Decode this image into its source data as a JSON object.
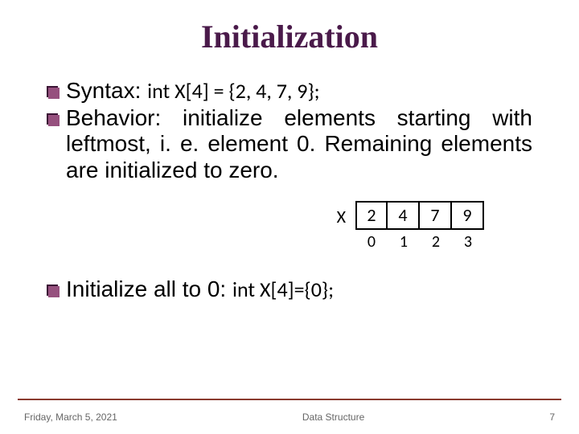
{
  "title": "Initialization",
  "bullets": {
    "b1": {
      "prefix": "Syntax: ",
      "code": "int X[4] = {2, 4, 7, 9};"
    },
    "b2": {
      "text": "Behavior: initialize elements starting with leftmost, i. e. element 0. Remaining elements are initialized to zero."
    },
    "b3": {
      "prefix": "Initialize all to 0: ",
      "code": "int X[4]={0};"
    }
  },
  "array": {
    "label": "X",
    "cells": [
      "2",
      "4",
      "7",
      "9"
    ],
    "indices": [
      "0",
      "1",
      "2",
      "3"
    ]
  },
  "footer": {
    "date": "Friday, March 5, 2021",
    "center": "Data Structure",
    "page": "7"
  }
}
